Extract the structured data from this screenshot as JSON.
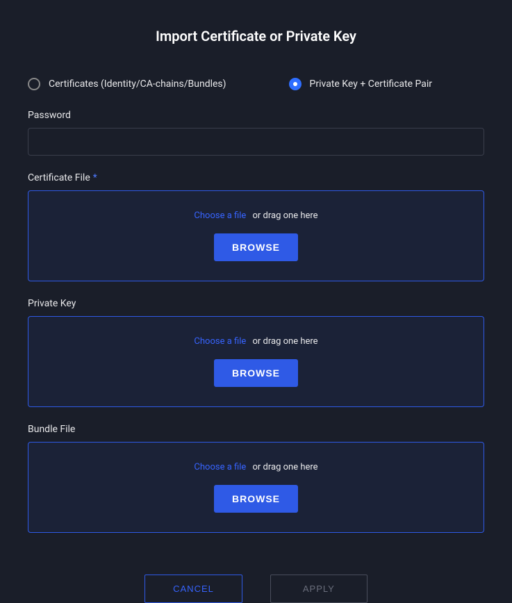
{
  "title": "Import Certificate or Private Key",
  "radios": {
    "certificates": {
      "label": "Certificates (Identity/CA-chains/Bundles)",
      "selected": false
    },
    "private_key_pair": {
      "label": "Private Key + Certificate Pair",
      "selected": true
    }
  },
  "fields": {
    "password": {
      "label": "Password",
      "value": ""
    },
    "certificate_file": {
      "label": "Certificate File",
      "required": true,
      "choose_text": "Choose a file",
      "drag_text": "or drag one here",
      "browse_label": "BROWSE"
    },
    "private_key": {
      "label": "Private Key",
      "required": false,
      "choose_text": "Choose a file",
      "drag_text": "or drag one here",
      "browse_label": "BROWSE"
    },
    "bundle_file": {
      "label": "Bundle File",
      "required": false,
      "choose_text": "Choose a file",
      "drag_text": "or drag one here",
      "browse_label": "BROWSE"
    }
  },
  "buttons": {
    "cancel": "CANCEL",
    "apply": "APPLY"
  },
  "required_marker": "*"
}
